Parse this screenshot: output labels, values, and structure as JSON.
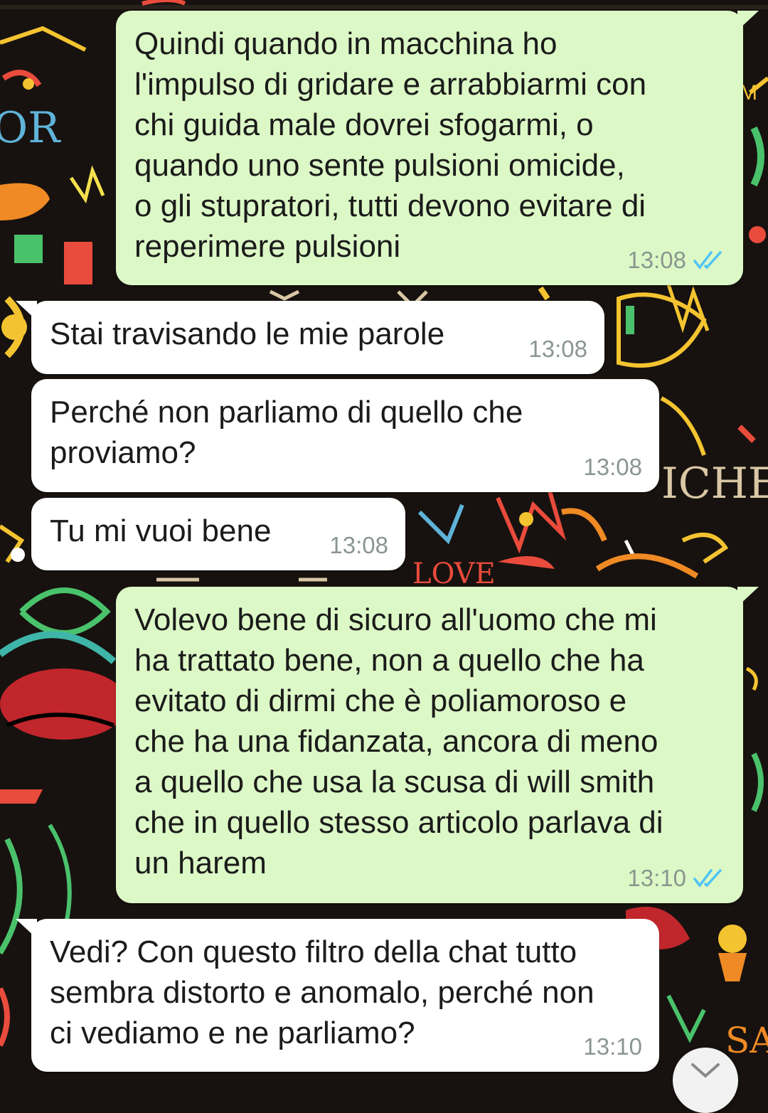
{
  "colors": {
    "outgoing_bubble": "#dcf8c6",
    "incoming_bubble": "#ffffff",
    "read_ticks": "#4fc3f7",
    "timestamp": "#8a968f",
    "wallpaper": "#17120f"
  },
  "messages": [
    {
      "direction": "outgoing",
      "text": "Quindi quando in macchina ho\nl'impulso di gridare e arrabbiarmi con\nchi guida male dovrei sfogarmi, o\nquando uno sente pulsioni omicide,\no gli stupratori, tutti devono evitare di\nreperimere pulsioni",
      "time": "13:08",
      "status_icon": "double-check-read-icon"
    },
    {
      "direction": "incoming",
      "text": "Stai travisando le mie parole",
      "time": "13:08"
    },
    {
      "direction": "incoming",
      "text": "Perché non parliamo di quello che\nproviamo?",
      "time": "13:08"
    },
    {
      "direction": "incoming",
      "text": "Tu mi vuoi bene",
      "time": "13:08"
    },
    {
      "direction": "outgoing",
      "text": "Volevo bene di sicuro all'uomo che mi\nha trattato bene, non a quello che ha\nevitato di dirmi che è poliamoroso e\nche ha una fidanzata, ancora di meno\na quello che usa la scusa di will smith\nche in quello stesso articolo parlava di\nun harem",
      "time": "13:10",
      "status_icon": "double-check-read-icon"
    },
    {
      "direction": "incoming",
      "text": "Vedi? Con questo filtro della chat tutto\nsembra distorto e anomalo, perché non\nci vediamo e ne parliamo?",
      "time": "13:10"
    }
  ],
  "scroll_button_icon": "chevron-down-icon"
}
